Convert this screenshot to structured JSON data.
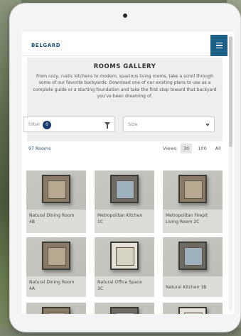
{
  "brand": "BELGARD",
  "gallery": {
    "title": "ROOMS GALLERY",
    "description": "From cozy, rustic kitchens to modern, spacious living rooms, take a scroll through some of our favorite backyards. Download one of our existing plans to use as a complete guide or a starting foundation and take the first step toward that backyard you've been dreaming of."
  },
  "filter": {
    "label": "Filter",
    "badge": "0"
  },
  "size": {
    "placeholder": "Size"
  },
  "results": {
    "count": "97 Rooms"
  },
  "views": {
    "label": "Views:",
    "options": [
      "30",
      "100",
      "All"
    ],
    "active": "30"
  },
  "rooms": [
    {
      "line1": "Natural Dining Room",
      "line2": "4B"
    },
    {
      "line1": "Metropolitan Kitchen",
      "line2": "1C"
    },
    {
      "line1": "Metropolitan Firepit",
      "line2": "Living Room 2C"
    },
    {
      "line1": "Natural Dining Room",
      "line2": "4A"
    },
    {
      "line1": "Natural Office Space",
      "line2": "3C"
    },
    {
      "line1": "Natural Kitchen 1B",
      "line2": ""
    }
  ]
}
